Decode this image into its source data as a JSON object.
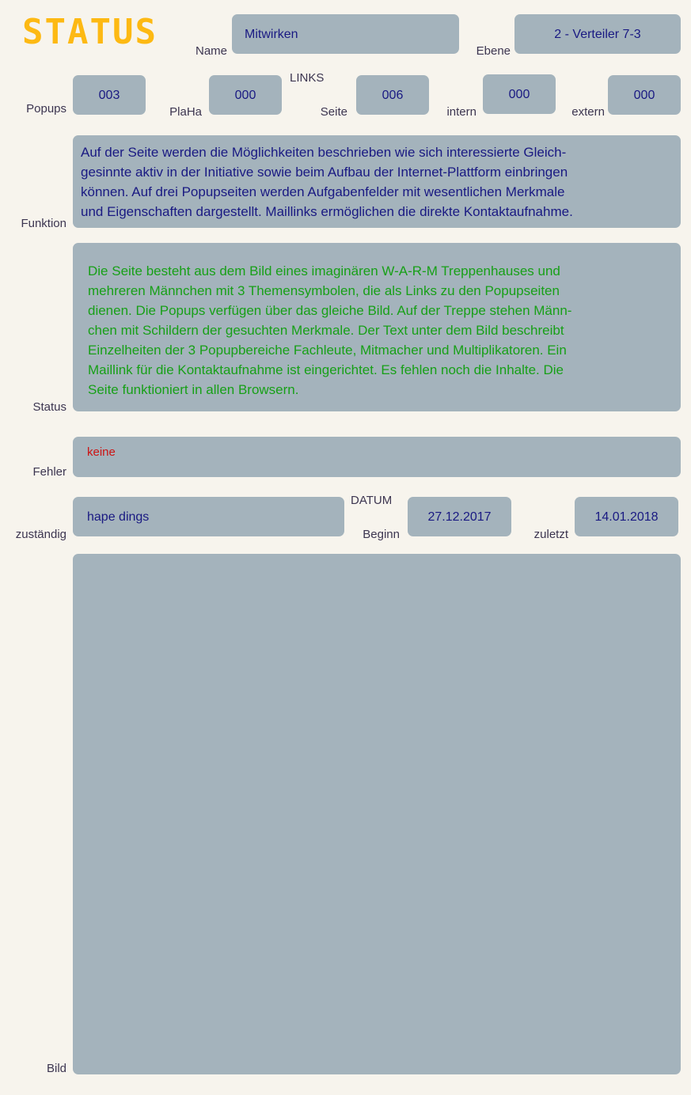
{
  "title": "STATUS",
  "header": {
    "name_label": "Name",
    "name_value": "Mitwirken",
    "ebene_label": "Ebene",
    "ebene_value": "2 - Verteiler 7-3"
  },
  "counters": {
    "links_group_label": "LINKS",
    "popups_label": "Popups",
    "popups_value": "003",
    "plaha_label": "PlaHa",
    "plaha_value": "000",
    "seite_label": "Seite",
    "seite_value": "006",
    "intern_label": "intern",
    "intern_value": "000",
    "extern_label": "extern",
    "extern_value": "000"
  },
  "funktion": {
    "label": "Funktion",
    "text": "Auf der Seite werden die Möglichkeiten beschrieben wie sich interessierte Gleich-\ngesinnte aktiv in der Initiative sowie beim Aufbau der Internet-Plattform einbringen\nkönnen. Auf drei Popupseiten werden Aufgabenfelder mit wesentlichen Merkmale\nund Eigenschaften dargestellt. Maillinks ermöglichen die direkte Kontaktaufnahme."
  },
  "status": {
    "label": "Status",
    "text": "Die Seite besteht aus dem Bild eines imaginären W-A-R-M Treppenhauses und\nmehreren Männchen mit 3 Themensymbolen, die als Links zu den Popupseiten\ndienen. Die Popups verfügen über das gleiche Bild. Auf der Treppe stehen Männ-\nchen mit Schildern der gesuchten Merkmale. Der Text unter dem Bild beschreibt\nEinzelheiten der 3 Popupbereiche Fachleute, Mitmacher und Multiplikatoren. Ein\nMaillink für die Kontaktaufnahme ist eingerichtet. Es fehlen noch die Inhalte. Die\nSeite funktioniert in allen Browsern."
  },
  "fehler": {
    "label": "Fehler",
    "text": "keine"
  },
  "footer": {
    "zustaendig_label": "zuständig",
    "zustaendig_value": "hape dings",
    "datum_group_label": "DATUM",
    "beginn_label": "Beginn",
    "beginn_value": "27.12.2017",
    "zuletzt_label": "zuletzt",
    "zuletzt_value": "14.01.2018"
  },
  "bild": {
    "label": "Bild",
    "value": ""
  },
  "colors": {
    "page_background": "#f7f4ed",
    "field_fill": "#a4b3bc",
    "label_text": "#3c3550",
    "value_text": "#191982",
    "title_accent": "#fdb913",
    "status_green": "#17a017",
    "error_red": "#cc1414"
  }
}
